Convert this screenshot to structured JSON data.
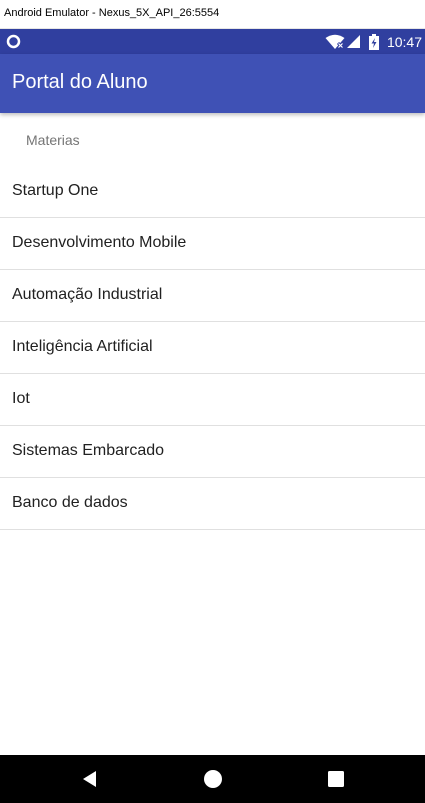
{
  "window": {
    "title": "Android Emulator - Nexus_5X_API_26:5554"
  },
  "status_bar": {
    "time": "10:47",
    "icons": [
      "circle-notification-icon",
      "wifi-icon",
      "signal-icon",
      "battery-charging-icon"
    ]
  },
  "app_bar": {
    "title": "Portal do Aluno"
  },
  "section": {
    "header": "Materias"
  },
  "subjects": [
    {
      "label": "Startup One"
    },
    {
      "label": "Desenvolvimento Mobile"
    },
    {
      "label": "Automação Industrial"
    },
    {
      "label": "Inteligência Artificial"
    },
    {
      "label": "Iot"
    },
    {
      "label": "Sistemas Embarcado"
    },
    {
      "label": "Banco de dados"
    }
  ],
  "nav_bar": {
    "icons": [
      "back-icon",
      "home-icon",
      "recents-icon"
    ]
  },
  "colors": {
    "status_bar": "#303f9f",
    "app_bar": "#3f51b5",
    "nav_bar": "#000000",
    "divider": "#e0e0e0"
  }
}
